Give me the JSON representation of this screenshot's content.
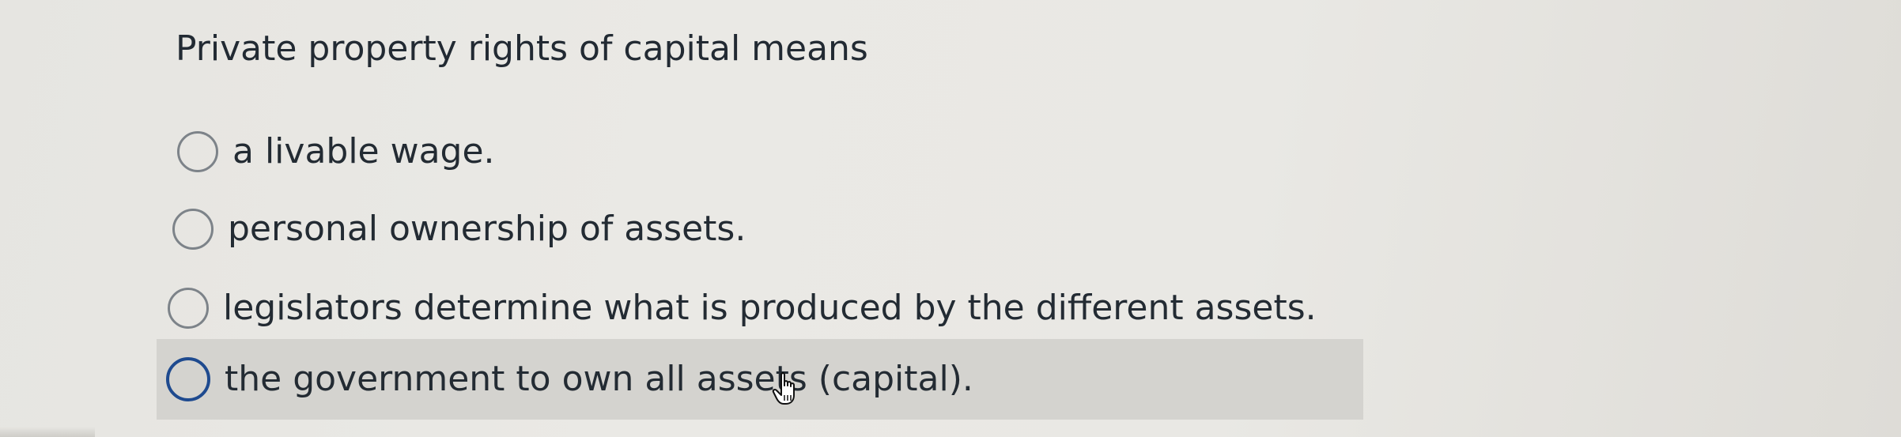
{
  "question": {
    "text": "Private property rights of capital means"
  },
  "options": [
    {
      "label": "a livable wage.",
      "selected": false
    },
    {
      "label": "personal ownership of assets.",
      "selected": false
    },
    {
      "label": "legislators determine what is produced by the different assets.",
      "selected": false
    },
    {
      "label": "the government to own all assets (capital).",
      "selected": false,
      "hovered": true
    }
  ],
  "colors": {
    "background": "#e8e7e3",
    "hover_row": "#d4d3cf",
    "radio_border": "#7d8389",
    "radio_focus_border": "#1e4a8f",
    "text": "#232b33"
  },
  "cursor": {
    "icon": "hand-pointer-icon"
  }
}
